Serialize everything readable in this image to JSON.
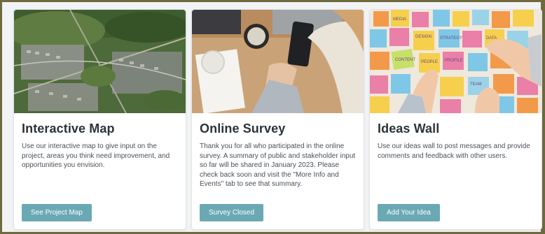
{
  "cards": [
    {
      "image": "aerial-neighborhood-photo",
      "title": "Interactive Map",
      "description": "Use our interactive map to give input on the project, areas you think need improvement, and opportunities you envision.",
      "button": "See Project Map"
    },
    {
      "image": "desk-phone-coffee-photo",
      "title": "Online Survey",
      "description": "Thank you for all who participated in the online survey. A summary of public and stakeholder input so far will be shared in January 2023. Please check back soon and visit the \"More Info and Events\" tab to see that summary.",
      "button": "Survey Closed"
    },
    {
      "image": "sticky-notes-wall-photo",
      "title": "Ideas Wall",
      "description": "Use our ideas wall to post messages and provide comments and feedback with other users.",
      "button": "Add Your Idea"
    }
  ],
  "sticky_note_words": [
    "MEDIA",
    "DESIGN",
    "STRATEGY",
    "DATA",
    "PEOPLE",
    "PROFILE",
    "CONTENT",
    "TEAM"
  ],
  "colors": {
    "button": "#6aa9b4",
    "frame": "#6f6a3e",
    "background": "#f2f3f4"
  }
}
